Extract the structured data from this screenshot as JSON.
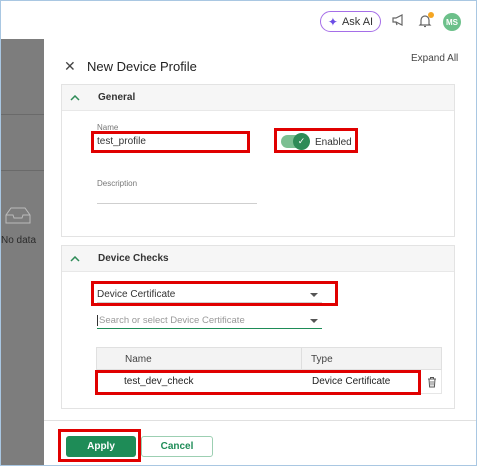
{
  "topbar": {
    "ask_ai_label": "Ask AI",
    "avatar_initials": "MS"
  },
  "background": {
    "no_data_text": "No data"
  },
  "panel": {
    "title": "New Device Profile",
    "expand_all_label": "Expand All"
  },
  "general_section": {
    "title": "General",
    "name_label": "Name",
    "name_value": "test_profile",
    "toggle_label": "Enabled",
    "description_label": "Description",
    "description_value": ""
  },
  "device_checks_section": {
    "title": "Device Checks",
    "type_select_value": "Device Certificate",
    "search_placeholder": "Search or select Device Certificate",
    "table": {
      "columns": [
        "Name",
        "Type"
      ],
      "rows": [
        {
          "name": "test_dev_check",
          "type": "Device Certificate"
        }
      ]
    }
  },
  "footer": {
    "apply_label": "Apply",
    "cancel_label": "Cancel"
  },
  "colors": {
    "accent": "#1e8c57",
    "highlight": "#e00000",
    "ask_ai_border": "#a56ee8"
  }
}
